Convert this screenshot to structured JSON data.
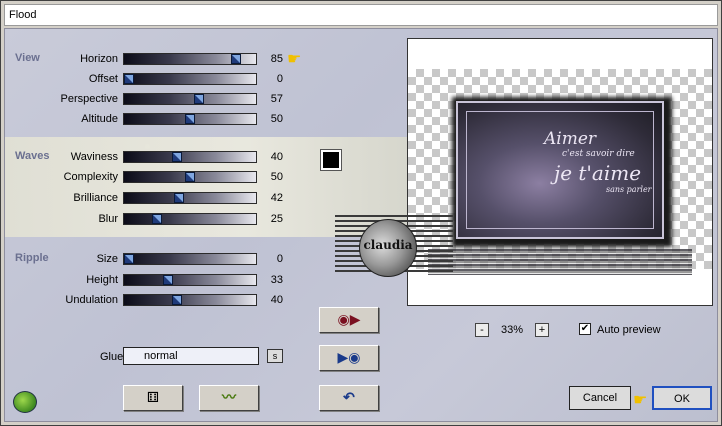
{
  "window": {
    "title": "Flood"
  },
  "sections": {
    "view": "View",
    "waves": "Waves",
    "ripple": "Ripple"
  },
  "params": {
    "horizon": {
      "label": "Horizon",
      "value": "85",
      "level": 0.85
    },
    "offset": {
      "label": "Offset",
      "value": "0",
      "level": 0.0
    },
    "perspective": {
      "label": "Perspective",
      "value": "57",
      "level": 0.57
    },
    "altitude": {
      "label": "Altitude",
      "value": "50",
      "level": 0.5
    },
    "waviness": {
      "label": "Waviness",
      "value": "40",
      "level": 0.4
    },
    "complexity": {
      "label": "Complexity",
      "value": "50",
      "level": 0.5
    },
    "brilliance": {
      "label": "Brilliance",
      "value": "42",
      "level": 0.42
    },
    "blur": {
      "label": "Blur",
      "value": "25",
      "level": 0.25
    },
    "size": {
      "label": "Size",
      "value": "0",
      "level": 0.0
    },
    "height": {
      "label": "Height",
      "value": "33",
      "level": 0.33
    },
    "undulation": {
      "label": "Undulation",
      "value": "40",
      "level": 0.4
    }
  },
  "color_swatch": "#000000",
  "glue": {
    "label": "Glue",
    "value": "normal",
    "s_button": "s"
  },
  "preview": {
    "art_line1": "Aimer",
    "art_line2": "c'est savoir dire",
    "art_line3": "je t'aime",
    "art_line4": "sans parler",
    "watermark": "claudia"
  },
  "zoom": {
    "minus": "-",
    "value": "33%",
    "plus": "+"
  },
  "auto_preview": {
    "label": "Auto preview",
    "checked": "✔"
  },
  "buttons": {
    "cancel": "Cancel",
    "ok": "OK"
  },
  "icons": {
    "hand_pointer": "☛",
    "dice": "⚅",
    "wave": "〰",
    "undo": "↶",
    "preset_load": "◉▶",
    "preset_save": "▶◉"
  }
}
